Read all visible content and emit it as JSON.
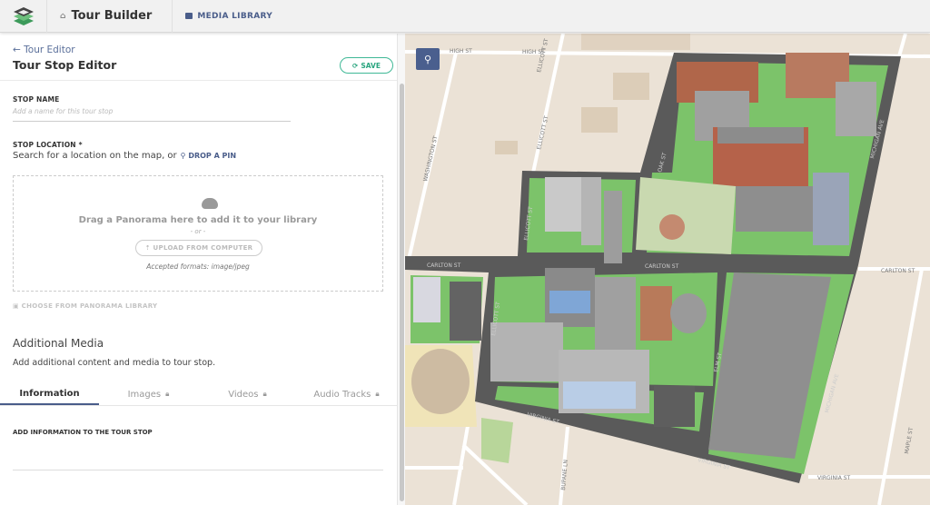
{
  "header": {
    "brand": "Tour Builder",
    "media_library": "MEDIA LIBRARY"
  },
  "editor": {
    "back_link": "← Tour Editor",
    "title": "Tour Stop Editor",
    "save_label": "SAVE",
    "stop_name_label": "STOP NAME",
    "stop_name_placeholder": "Add a name for this tour stop",
    "stop_location_label": "STOP LOCATION *",
    "stop_location_text": "Search for a location on the map, or",
    "drop_pin": "DROP A PIN",
    "drop_text": "Drag a Panorama here to add it to your library",
    "or": "- or -",
    "upload": "UPLOAD FROM COMPUTER",
    "formats": "Accepted formats: image/jpeg",
    "choose_library": "CHOOSE FROM PANORAMA LIBRARY",
    "additional_title": "Additional Media",
    "additional_sub": "Add additional content and media to tour stop.",
    "tabs": [
      {
        "label": "Information",
        "locked": false
      },
      {
        "label": "Images",
        "locked": true
      },
      {
        "label": "Videos",
        "locked": true
      },
      {
        "label": "Audio Tracks",
        "locked": true
      }
    ],
    "info_label": "ADD INFORMATION TO THE TOUR STOP"
  },
  "map": {
    "streets": {
      "high1": "HIGH ST",
      "high2": "HIGH ST",
      "washington": "WASHINGTON ST",
      "ellicott1": "ELLICOTT ST",
      "ellicott2": "ELLICOTT ST",
      "ellicott3": "ELLICOTT ST",
      "ellicott4": "ELLICOTT ST",
      "oak": "OAK ST",
      "michigan1": "MICHIGAN AVE",
      "michigan2": "MICHIGAN AVE",
      "carlton1": "CARLTON ST",
      "carlton2": "CARLTON ST",
      "carlton3": "CARLTON ST",
      "virginia1": "VIRGINIA ST",
      "virginia2": "VIRGINIA ST",
      "virginia3": "VIRGINIA ST",
      "elm": "ELM ST",
      "maple": "MAPLE ST",
      "bupane": "BUPANE LN"
    },
    "colors": {
      "land": "#ebe2d6",
      "road": "#5a5a5a",
      "grass": "#7cc36a",
      "building": "#9a9a9a",
      "brick": "#b0664a"
    }
  }
}
